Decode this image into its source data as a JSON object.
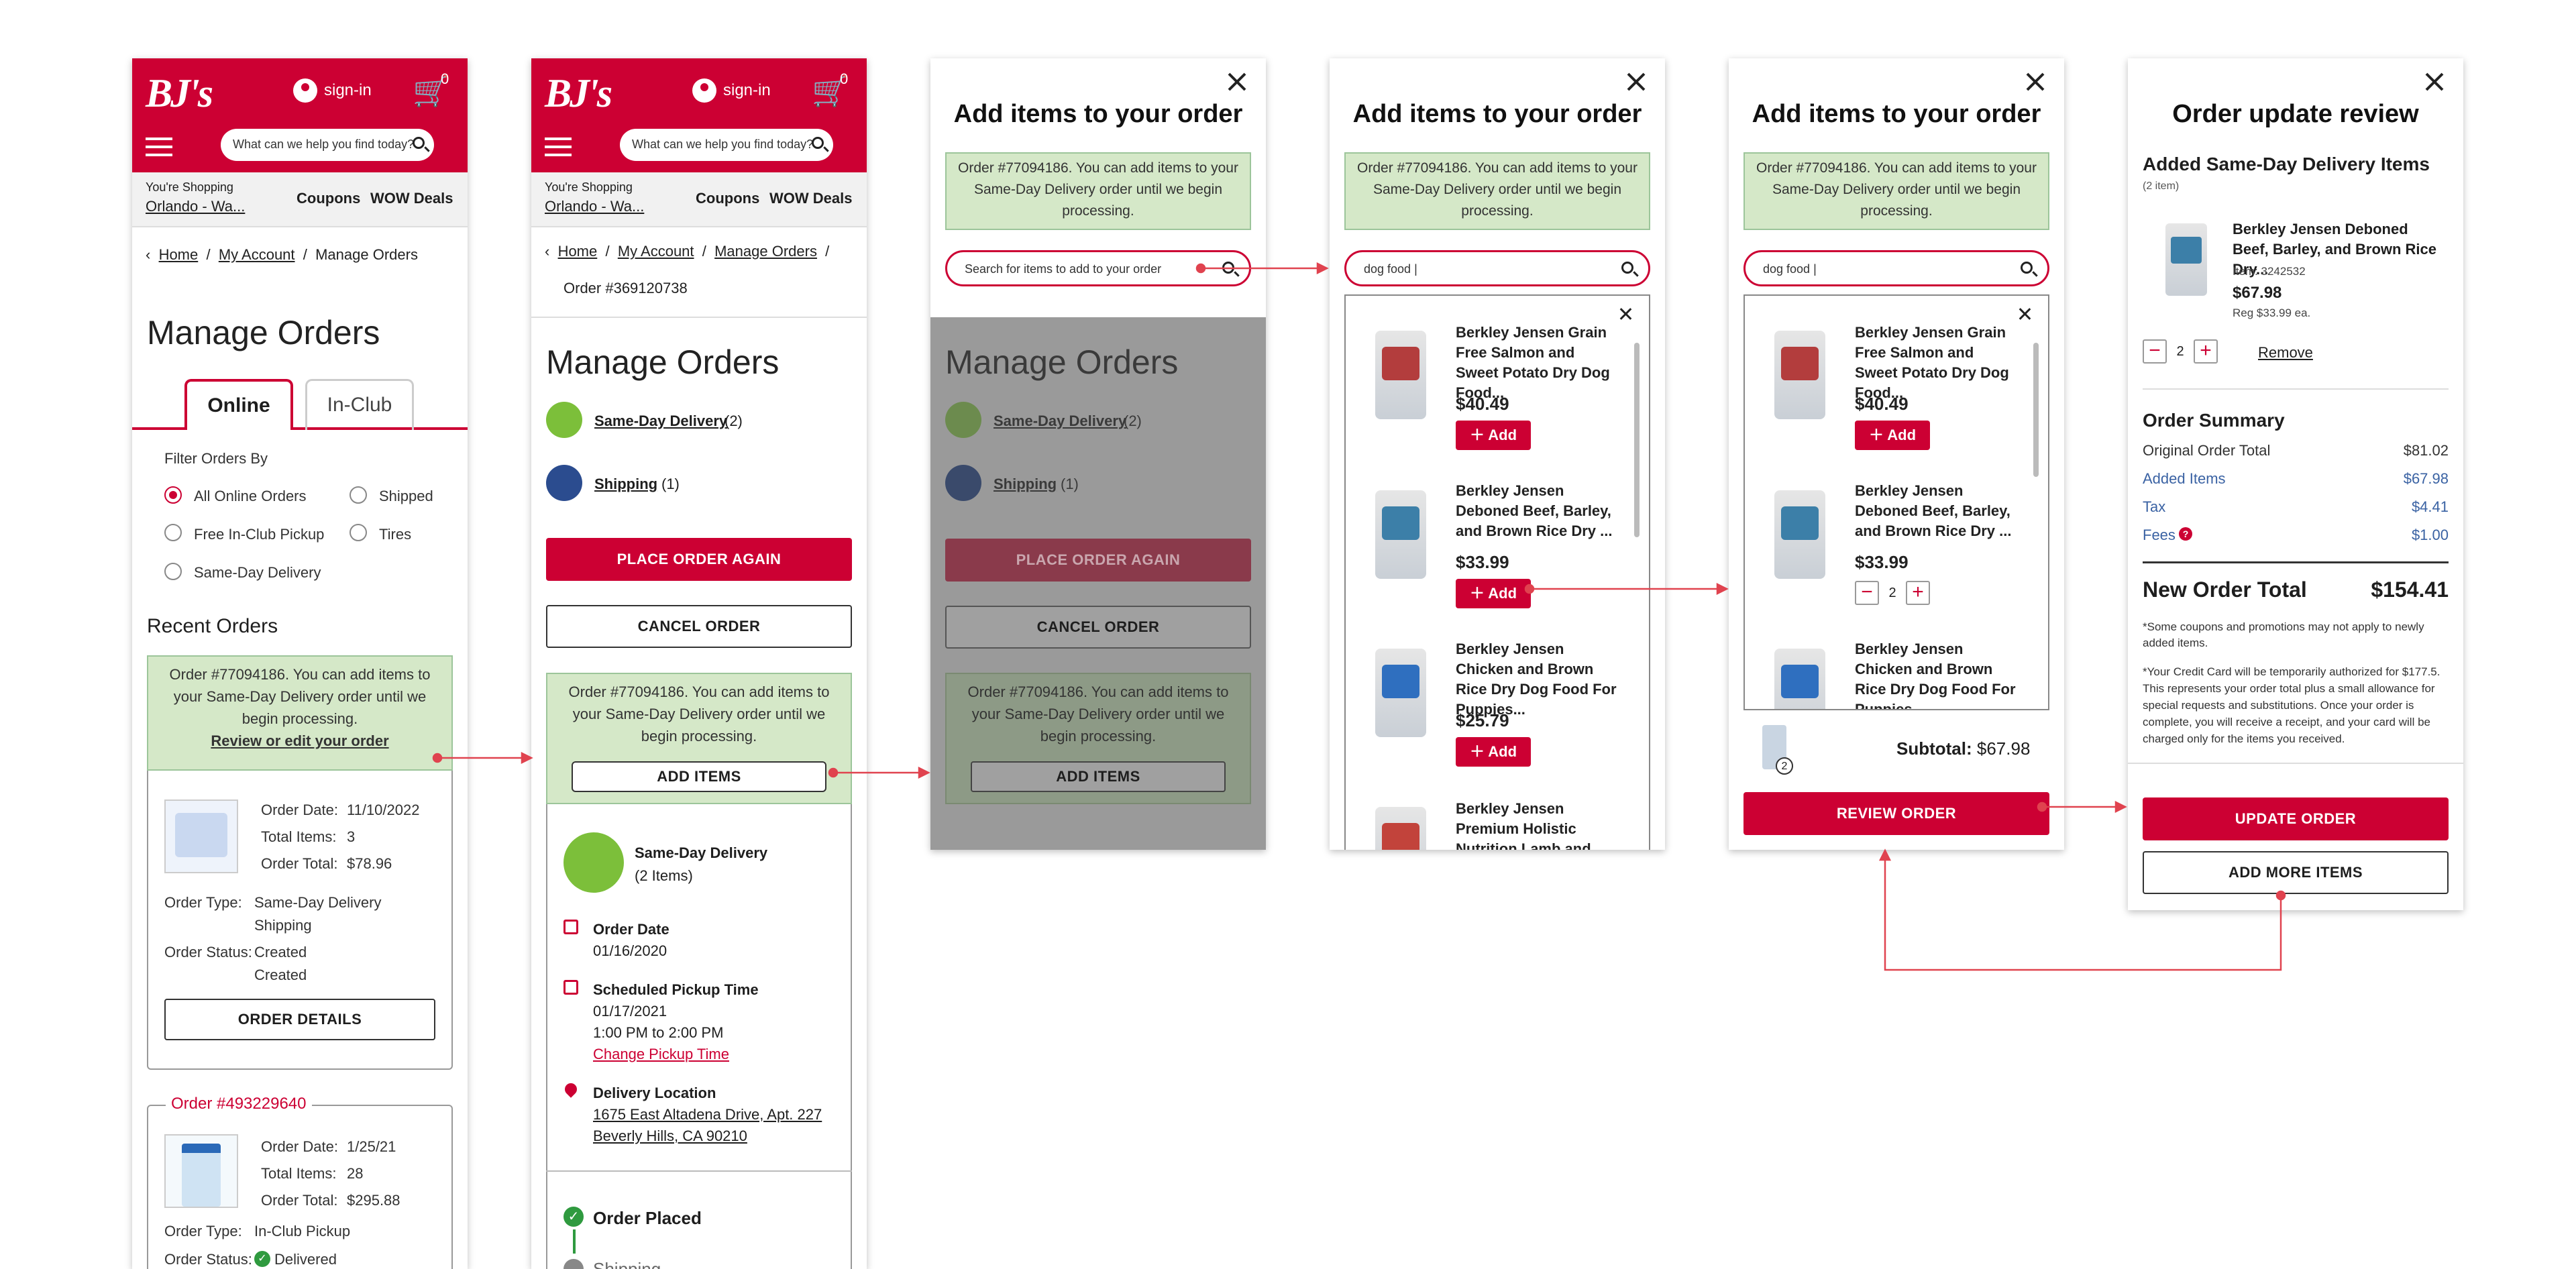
{
  "header": {
    "logo": "BJ's",
    "sign_in": "sign-in",
    "cart_count": "0",
    "search_placeholder": "What can we help you find today?",
    "shopping_label": "You're Shopping",
    "location": "Orlando - Wa...",
    "coupons": "Coupons",
    "wow_deals": "WOW Deals"
  },
  "screen1": {
    "breadcrumb": [
      "Home",
      "My Account",
      "Manage Orders"
    ],
    "title": "Manage Orders",
    "tabs": [
      "Online",
      "In-Club"
    ],
    "filter_label": "Filter Orders By",
    "filters": [
      "All Online Orders",
      "Shipped",
      "Free In-Club Pickup",
      "Tires",
      "Same-Day Delivery"
    ],
    "recent_orders": "Recent Orders",
    "notice": "Order #77094186. You can add items to your Same-Day Delivery order until we begin processing.",
    "review_link": "Review or edit your order",
    "order1": {
      "date_label": "Order Date:",
      "date": "11/10/2022",
      "items_label": "Total Items:",
      "items": "3",
      "total_label": "Order Total:",
      "total": "$78.96",
      "type_label": "Order Type:",
      "type1": "Same-Day Delivery",
      "type2": "Shipping",
      "status_label": "Order Status:",
      "status1": "Created",
      "status2": "Created",
      "details_btn": "ORDER DETAILS"
    },
    "order2": {
      "number": "Order #493229640",
      "date_label": "Order Date:",
      "date": "1/25/21",
      "items_label": "Total Items:",
      "items": "28",
      "total_label": "Order Total:",
      "total": "$295.88",
      "type_label": "Order Type:",
      "type": "In-Club Pickup",
      "status_label": "Order Status:",
      "status": "Delivered"
    }
  },
  "screen2": {
    "breadcrumb": [
      "Home",
      "My Account",
      "Manage Orders",
      "Order #369120738"
    ],
    "title": "Manage Orders",
    "sameday_link": "Same-Day Delivery",
    "sameday_count": "(2)",
    "shipping_link": "Shipping",
    "shipping_count": "(1)",
    "place_again": "PLACE ORDER AGAIN",
    "cancel": "CANCEL ORDER",
    "notice": "Order #77094186. You can add items to your Same-Day Delivery order until we begin processing.",
    "add_items": "ADD ITEMS",
    "delivery_title": "Same-Day Delivery",
    "delivery_items": "(2 Items)",
    "order_date_label": "Order Date",
    "order_date": "01/16/2020",
    "pickup_label": "Scheduled Pickup Time",
    "pickup_date": "01/17/2021",
    "pickup_time": "1:00 PM to 2:00 PM",
    "change_pickup": "Change Pickup Time",
    "location_label": "Delivery Location",
    "address1": "1675 East Altadena Drive, Apt. 227",
    "address2": "Beverly Hills, CA 90210",
    "order_placed": "Order Placed",
    "shipping_status": "Shipping"
  },
  "modal": {
    "title": "Add items to your order",
    "notice": "Order #77094186. You can add items to your Same-Day Delivery order until we begin processing.",
    "search_placeholder": "Search for items to add to your order",
    "search_value": "dog food |",
    "add_label": "Add",
    "products": [
      {
        "name": "Berkley Jensen Grain Free Salmon and Sweet Potato Dry Dog Food...",
        "price": "$40.49"
      },
      {
        "name": "Berkley Jensen Deboned Beef, Barley, and Brown Rice Dry ...",
        "price": "$33.99"
      },
      {
        "name": "Berkley Jensen Chicken and Brown Rice Dry Dog Food For Puppies...",
        "price": "$25.79"
      },
      {
        "name": "Berkley Jensen Premium Holistic Nutrition Lamb and...",
        "price": ""
      }
    ],
    "qty": "2",
    "subtotal_label": "Subtotal:",
    "subtotal": "$67.98",
    "review_btn": "REVIEW ORDER",
    "cart_badge": "2"
  },
  "review": {
    "title": "Order update review",
    "added_heading": "Added Same-Day Delivery Items",
    "added_count": "(2 item)",
    "item_name": "Berkley Jensen Deboned Beef, Barley, and Brown Rice Dry...",
    "item_number": "Item: 3242532",
    "item_price": "$67.98",
    "item_reg": "Reg $33.99 ea.",
    "qty": "2",
    "remove": "Remove",
    "summary_heading": "Order Summary",
    "rows": [
      {
        "label": "Original Order Total",
        "value": "$81.02"
      },
      {
        "label": "Added Items",
        "value": "$67.98"
      },
      {
        "label": "Tax",
        "value": "$4.41"
      },
      {
        "label": "Fees",
        "value": "$1.00"
      }
    ],
    "new_total_label": "New Order Total",
    "new_total": "$154.41",
    "note1": "*Some coupons and promotions may not apply to newly added items.",
    "note2": "*Your Credit Card will be temporarily authorized for $177.5. This represents your order total plus a small allowance for special requests and substitutions. Once your order is complete, you will receive a receipt, and your card will be charged only for the items you received.",
    "update_btn": "UPDATE ORDER",
    "add_more_btn": "ADD MORE ITEMS"
  },
  "colors": {
    "brand_red": "#cc0033",
    "notice_green": "#d5e8c8",
    "link_blue": "#3a62a3",
    "dim_overlay": "#9a9a9a"
  }
}
